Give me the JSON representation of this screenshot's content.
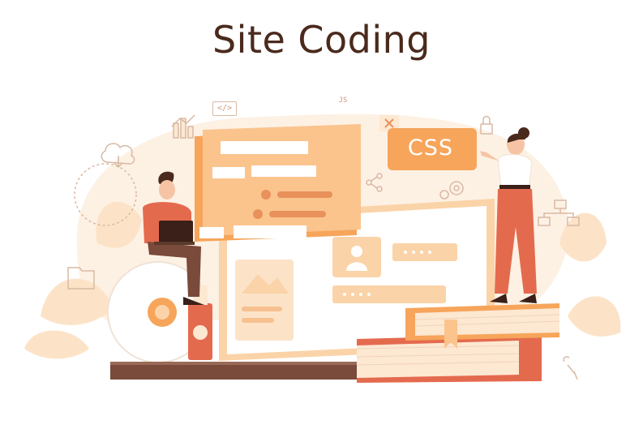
{
  "title": "Site Coding",
  "code_badge": "CSS",
  "html_tag": "</>",
  "js_tag": "JS",
  "colors": {
    "accent_orange": "#f6a55b",
    "light_orange": "#fbd3a8",
    "pale_peach": "#fdeede",
    "red": "#e46a4e",
    "dark_brown": "#4a2a1d"
  }
}
